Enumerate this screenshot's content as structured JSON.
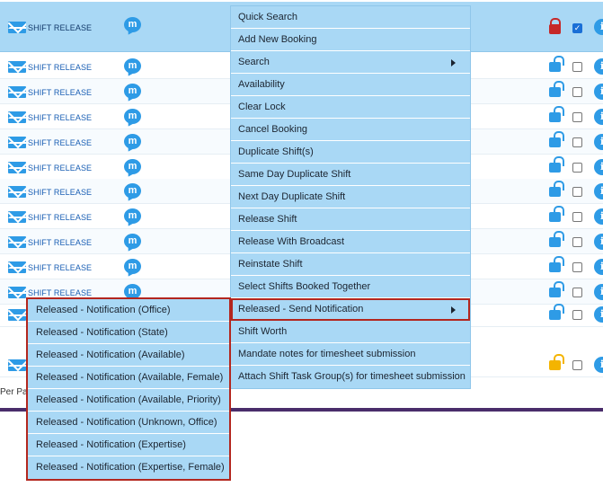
{
  "table": {
    "release_label": "SHIFT RELEASE",
    "message_icon_letter": "m",
    "info_icon_letter": "i",
    "per_page_label": "Per Pa",
    "selected_checkmark": "✓"
  },
  "context_menu": {
    "items": [
      {
        "label": "Quick Search"
      },
      {
        "label": "Add New Booking"
      },
      {
        "label": "Search"
      },
      {
        "label": "Availability"
      },
      {
        "label": "Clear Lock"
      },
      {
        "label": "Cancel Booking"
      },
      {
        "label": "Duplicate Shift(s)"
      },
      {
        "label": "Same Day Duplicate Shift"
      },
      {
        "label": "Next Day Duplicate Shift"
      },
      {
        "label": "Release Shift"
      },
      {
        "label": "Release With Broadcast"
      },
      {
        "label": "Reinstate Shift"
      },
      {
        "label": "Select Shifts Booked Together"
      },
      {
        "label": "Released - Send Notification"
      },
      {
        "label": "Shift Worth"
      },
      {
        "label": "Mandate notes for timesheet submission"
      },
      {
        "label": "Attach Shift Task Group(s) for timesheet submission"
      }
    ]
  },
  "submenu": {
    "items": [
      {
        "label": "Released - Notification (Office)"
      },
      {
        "label": "Released - Notification (State)"
      },
      {
        "label": "Released - Notification (Available)"
      },
      {
        "label": "Released - Notification (Available, Female)"
      },
      {
        "label": "Released - Notification (Available, Priority)"
      },
      {
        "label": "Released - Notification (Unknown, Office)"
      },
      {
        "label": "Released - Notification (Expertise)"
      },
      {
        "label": "Released - Notification (Expertise, Female)"
      }
    ]
  },
  "colors": {
    "menu_bg": "#a9d8f5",
    "highlight_border": "#b3261e",
    "accent_blue": "#2e9be6",
    "lock_red": "#c62828",
    "lock_gold": "#f4b400",
    "footer_bar": "#4a2d6b"
  }
}
